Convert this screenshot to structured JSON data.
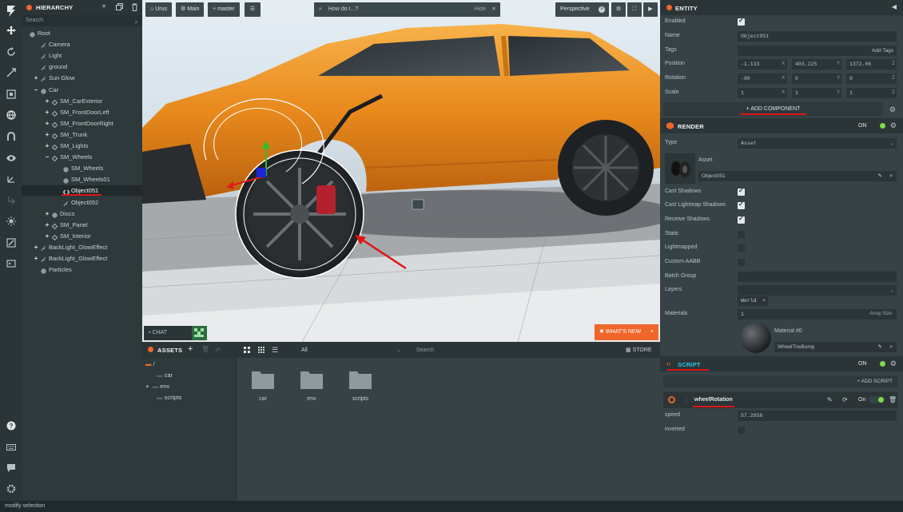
{
  "toolbar": {
    "tools": [
      "logo-icon",
      "translate-icon",
      "rotate-icon",
      "scale-icon",
      "resize-icon",
      "world-icon",
      "magnet-icon",
      "eye-icon",
      "gizmo-icon",
      "history-icon",
      "light-icon",
      "edit-icon",
      "code-icon"
    ],
    "bottom_tools": [
      "help-icon",
      "keyboard-icon",
      "chat-icon",
      "settings-icon"
    ]
  },
  "hierarchy": {
    "title": "HIERARCHY",
    "search_placeholder": "Search",
    "items": [
      {
        "label": "Root",
        "depth": 0,
        "expander": "",
        "icon": "entity"
      },
      {
        "label": "Camera",
        "depth": 1,
        "expander": "",
        "icon": "link"
      },
      {
        "label": "Light",
        "depth": 1,
        "expander": "",
        "icon": "link"
      },
      {
        "label": "ground",
        "depth": 1,
        "expander": "",
        "icon": "link"
      },
      {
        "label": "Sun Glow",
        "depth": 1,
        "expander": "+",
        "icon": "link"
      },
      {
        "label": "Car",
        "depth": 1,
        "expander": "–",
        "icon": "entity"
      },
      {
        "label": "SM_CarExterior",
        "depth": 2,
        "expander": "+",
        "icon": "diamond"
      },
      {
        "label": "SM_FrontDoorLeft",
        "depth": 2,
        "expander": "+",
        "icon": "diamond"
      },
      {
        "label": "SM_FrontDoorRight",
        "depth": 2,
        "expander": "+",
        "icon": "diamond"
      },
      {
        "label": "SM_Trunk",
        "depth": 2,
        "expander": "+",
        "icon": "diamond"
      },
      {
        "label": "SM_Lights",
        "depth": 2,
        "expander": "+",
        "icon": "diamond"
      },
      {
        "label": "SM_Wheels",
        "depth": 2,
        "expander": "–",
        "icon": "diamond"
      },
      {
        "label": "SM_Wheels",
        "depth": 3,
        "expander": "",
        "icon": "entity"
      },
      {
        "label": "SM_Wheels01",
        "depth": 3,
        "expander": "",
        "icon": "entity"
      },
      {
        "label": "Object051",
        "depth": 3,
        "expander": "",
        "icon": "code",
        "selected": true
      },
      {
        "label": "Object052",
        "depth": 3,
        "expander": "",
        "icon": "link"
      },
      {
        "label": "Discs",
        "depth": 2,
        "expander": "+",
        "icon": "entity"
      },
      {
        "label": "SM_Panel",
        "depth": 2,
        "expander": "+",
        "icon": "diamond"
      },
      {
        "label": "SM_Interior",
        "depth": 2,
        "expander": "+",
        "icon": "diamond"
      },
      {
        "label": "BackLight_GlowEffect",
        "depth": 1,
        "expander": "+",
        "icon": "link"
      },
      {
        "label": "BackLight_GlowEffect",
        "depth": 1,
        "expander": "+",
        "icon": "link"
      },
      {
        "label": "Particles",
        "depth": 1,
        "expander": "",
        "icon": "entity"
      }
    ]
  },
  "viewport": {
    "project_label": "Urus",
    "scene_label": "Main",
    "branch_label": "master",
    "search_placeholder": "How do I...?",
    "hide_label": "Hide",
    "camera_label": "Perspective",
    "chat_label": "CHAT",
    "whats_new_label": "WHAT'S NEW"
  },
  "assets": {
    "title": "ASSETS",
    "filter_value": "All",
    "search_placeholder": "Search",
    "store_label": "STORE",
    "root_label": "/",
    "tree": [
      "car",
      "env",
      "scripts"
    ],
    "folders": [
      "car",
      "env",
      "scripts"
    ]
  },
  "inspector": {
    "title": "ENTITY",
    "enabled_label": "Enabled",
    "name_label": "Name",
    "name_value": "Object051",
    "tags_label": "Tags",
    "add_tags_label": "Add Tags",
    "position_label": "Position",
    "position": [
      "-1.133",
      "403.225",
      "1372.06"
    ],
    "rotation_label": "Rotation",
    "rotation": [
      "-90",
      "0",
      "0"
    ],
    "scale_label": "Scale",
    "scale": [
      "1",
      "1",
      "1"
    ],
    "axes": [
      "X",
      "Y",
      "Z"
    ],
    "add_component_label": "ADD COMPONENT",
    "render": {
      "title": "RENDER",
      "on_label": "ON",
      "type_label": "Type",
      "type_value": "Asset",
      "asset_label": "Asset",
      "asset_value": "Object051",
      "cast_shadows_label": "Cast Shadows",
      "cast_lightmap_label": "Cast Lightmap Shadows",
      "receive_shadows_label": "Receive Shadows",
      "static_label": "Static",
      "lightmapped_label": "Lightmapped",
      "custom_aabb_label": "Custom AABB",
      "batch_group_label": "Batch Group",
      "layers_label": "Layers",
      "layer_tag": "World",
      "materials_label": "Materials",
      "materials_count": "1",
      "array_size_label": "Array Size",
      "material_slot_label": "Material #0",
      "material_value": "WheelTireBump"
    },
    "script": {
      "title": "SCRIPT",
      "on_label": "ON",
      "add_script_label": "+ ADD SCRIPT",
      "script_name": "wheelRotation",
      "script_on_label": "On",
      "speed_label": "speed",
      "speed_value": "57.2958",
      "inverted_label": "inverted"
    }
  },
  "status": {
    "text": "modify selection"
  },
  "colors": {
    "accent": "#f0662a",
    "toggle_on": "#7ddc4a",
    "panel": "#2e393c",
    "inspector": "#364245",
    "annotation_red": "#e01414"
  }
}
